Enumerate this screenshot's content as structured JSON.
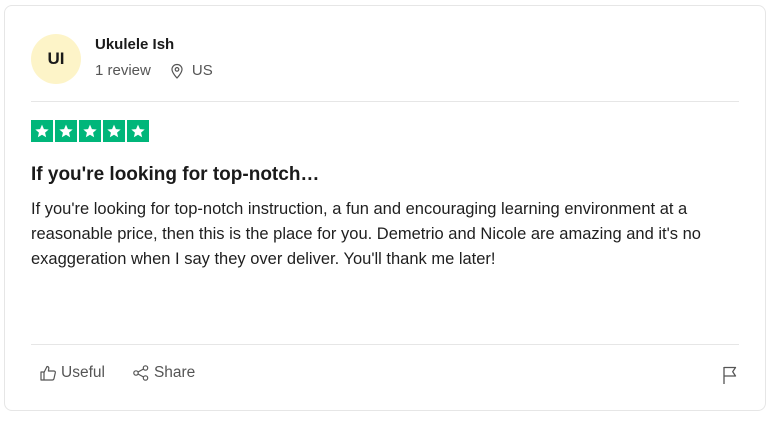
{
  "consumer": {
    "initials": "UI",
    "name": "Ukulele Ish",
    "reviews": "1 review",
    "location_icon": "location-pin-icon",
    "country": "US"
  },
  "review": {
    "rating": 5,
    "rating_max": 5,
    "star_color": "#00b67a",
    "title": "If you're looking for top-notch…",
    "text": "If you're looking for top-notch instruction, a fun and encouraging learning environment at a reasonable price, then this is the place for you. Demetrio and Nicole are amazing and it's no exaggeration when I say they over deliver. You'll thank me later!"
  },
  "actions": {
    "useful_label": "Useful",
    "useful_icon": "thumbs-up-icon",
    "share_label": "Share",
    "share_icon": "share-icon",
    "report_icon": "flag-icon"
  }
}
